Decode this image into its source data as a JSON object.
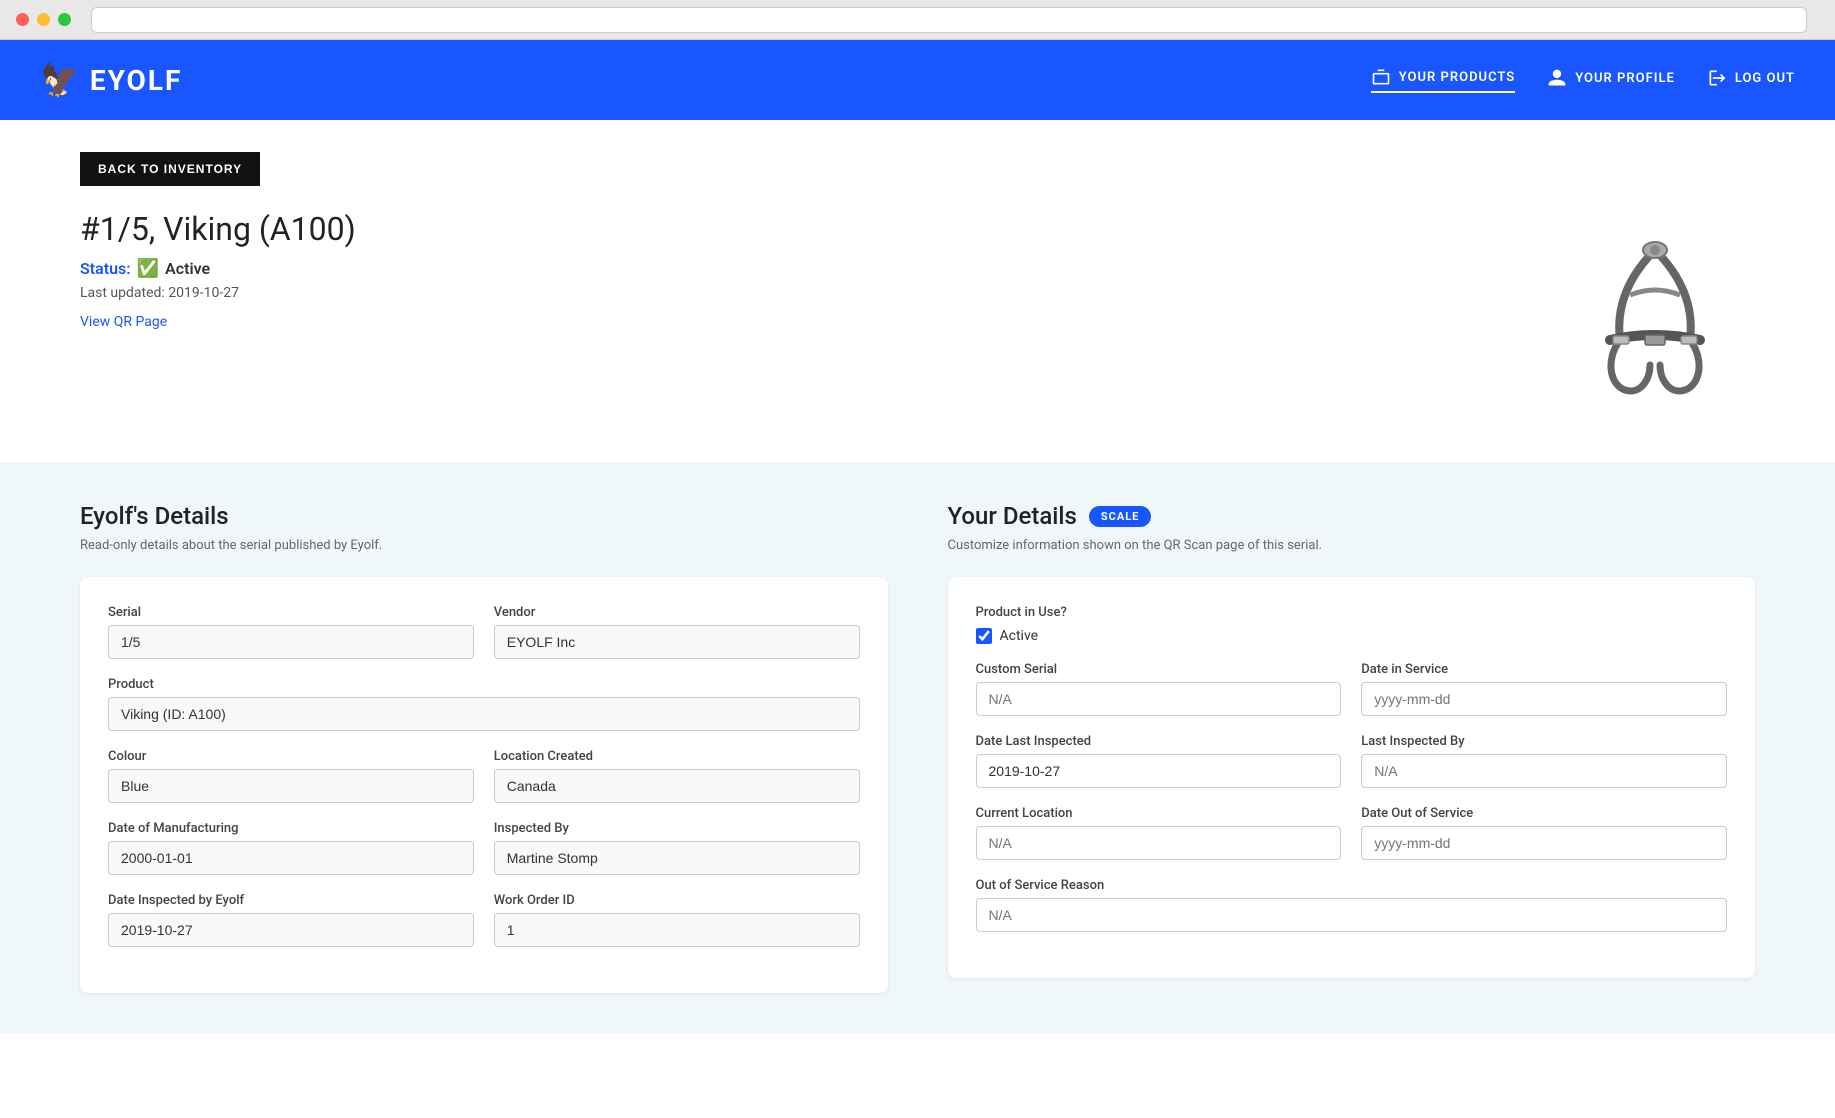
{
  "browser": {
    "url": ""
  },
  "nav": {
    "logo": "EYOLF",
    "links": [
      {
        "label": "YOUR PRODUCTS",
        "active": true
      },
      {
        "label": "YOUR PROFILE",
        "active": false
      },
      {
        "label": "LOG OUT",
        "active": false
      }
    ]
  },
  "page": {
    "back_button": "BACK TO INVENTORY",
    "title": "#1/5, Viking (A100)",
    "status_label": "Status:",
    "status_value": "Active",
    "last_updated_label": "Last updated:",
    "last_updated_date": "2019-10-27",
    "view_qr": "View QR Page"
  },
  "eyolf_details": {
    "title": "Eyolf's Details",
    "subtitle": "Read-only details about the serial published by Eyolf.",
    "fields": {
      "serial_label": "Serial",
      "serial_value": "1/5",
      "vendor_label": "Vendor",
      "vendor_value": "EYOLF Inc",
      "product_label": "Product",
      "product_value": "Viking (ID: A100)",
      "colour_label": "Colour",
      "colour_value": "Blue",
      "location_created_label": "Location Created",
      "location_created_value": "Canada",
      "date_of_manufacturing_label": "Date of Manufacturing",
      "date_of_manufacturing_value": "2000-01-01",
      "inspected_by_label": "Inspected By",
      "inspected_by_value": "Martine Stomp",
      "date_inspected_by_eyolf_label": "Date Inspected by Eyolf",
      "date_inspected_by_eyolf_value": "2019-10-27",
      "work_order_id_label": "Work Order ID",
      "work_order_id_value": "1"
    }
  },
  "your_details": {
    "title": "Your Details",
    "badge": "SCALE",
    "subtitle": "Customize information shown on the QR Scan page of this serial.",
    "product_in_use_label": "Product in Use?",
    "active_checkbox_label": "Active",
    "active_checked": true,
    "fields": {
      "custom_serial_label": "Custom Serial",
      "custom_serial_placeholder": "N/A",
      "date_in_service_label": "Date in Service",
      "date_in_service_placeholder": "yyyy-mm-dd",
      "date_last_inspected_label": "Date Last Inspected",
      "date_last_inspected_value": "2019-10-27",
      "last_inspected_by_label": "Last Inspected By",
      "last_inspected_by_placeholder": "N/A",
      "current_location_label": "Current Location",
      "current_location_placeholder": "N/A",
      "date_out_of_service_label": "Date Out of Service",
      "date_out_of_service_placeholder": "yyyy-mm-dd",
      "out_of_service_reason_label": "Out of Service Reason",
      "out_of_service_reason_placeholder": "N/A"
    }
  }
}
